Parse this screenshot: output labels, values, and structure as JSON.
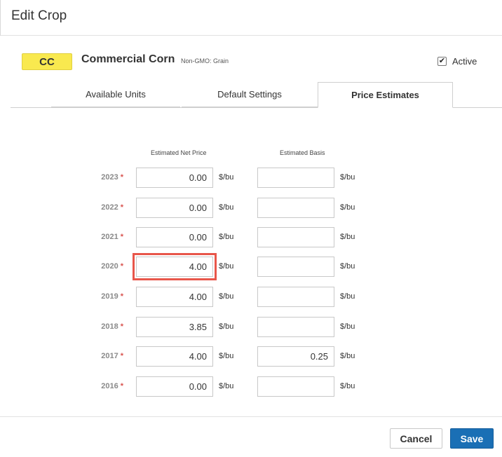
{
  "header": {
    "title": "Edit Crop"
  },
  "crop": {
    "badge": "CC",
    "badge_color": "#f9e94f",
    "name": "Commercial Corn",
    "subtitle": "Non-GMO: Grain",
    "active_label": "Active",
    "active_checked": true,
    "check_glyph": "✔"
  },
  "tabs": [
    {
      "label": "Available Units",
      "active": false
    },
    {
      "label": "Default Settings",
      "active": false
    },
    {
      "label": "Price Estimates",
      "active": true
    }
  ],
  "price_estimates": {
    "columns": {
      "net_price": "Estimated Net Price",
      "basis": "Estimated Basis"
    },
    "required_marker": "*",
    "rows": [
      {
        "year": "2023",
        "net_price": "0.00",
        "net_unit": "$/bu",
        "basis": "",
        "basis_unit": "$/bu"
      },
      {
        "year": "2022",
        "net_price": "0.00",
        "net_unit": "$/bu",
        "basis": "",
        "basis_unit": "$/bu"
      },
      {
        "year": "2021",
        "net_price": "0.00",
        "net_unit": "$/bu",
        "basis": "",
        "basis_unit": "$/bu"
      },
      {
        "year": "2020",
        "net_price": "4.00",
        "net_unit": "$/bu",
        "basis": "",
        "basis_unit": "$/bu",
        "highlighted": true
      },
      {
        "year": "2019",
        "net_price": "4.00",
        "net_unit": "$/bu",
        "basis": "",
        "basis_unit": "$/bu"
      },
      {
        "year": "2018",
        "net_price": "3.85",
        "net_unit": "$/bu",
        "basis": "",
        "basis_unit": "$/bu"
      },
      {
        "year": "2017",
        "net_price": "4.00",
        "net_unit": "$/bu",
        "basis": "0.25",
        "basis_unit": "$/bu"
      },
      {
        "year": "2016",
        "net_price": "0.00",
        "net_unit": "$/bu",
        "basis": "",
        "basis_unit": "$/bu"
      }
    ]
  },
  "footer": {
    "cancel_label": "Cancel",
    "save_label": "Save",
    "save_color": "#1a6fb5",
    "highlight_color": "#e8564a"
  }
}
